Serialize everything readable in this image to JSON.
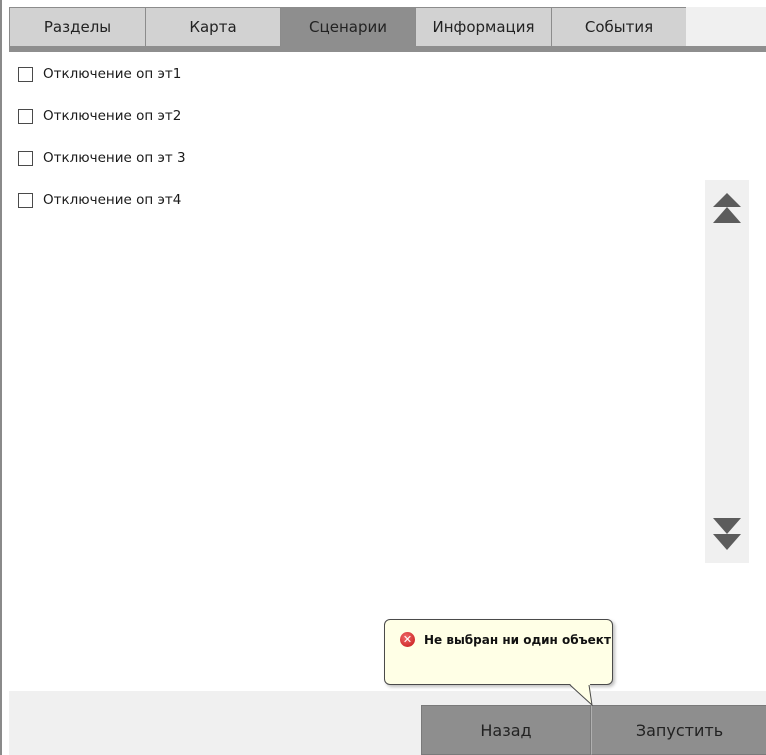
{
  "tabs": [
    {
      "label": "Разделы",
      "active": false
    },
    {
      "label": "Карта",
      "active": false
    },
    {
      "label": "Сценарии",
      "active": true
    },
    {
      "label": "Информация",
      "active": false
    },
    {
      "label": "События",
      "active": false
    }
  ],
  "scenarios": [
    {
      "label": "Отключение оп эт1",
      "checked": false
    },
    {
      "label": "Отключение оп эт2",
      "checked": false
    },
    {
      "label": "Отключение оп эт 3",
      "checked": false
    },
    {
      "label": "Отключение оп эт4",
      "checked": false
    }
  ],
  "scroll": {
    "up_icon": "double-chevron-up-icon",
    "down_icon": "double-chevron-down-icon"
  },
  "tooltip": {
    "icon": "error-icon",
    "message": "Не выбран ни один объект"
  },
  "buttons": {
    "back_label": "Назад",
    "run_label": "Запустить"
  },
  "colors": {
    "active_tab": "#8e8e8e",
    "inactive_tab": "#d2d2d2",
    "button": "#8e8e8e",
    "tooltip_bg": "#ffffe6",
    "error": "#c41616"
  }
}
